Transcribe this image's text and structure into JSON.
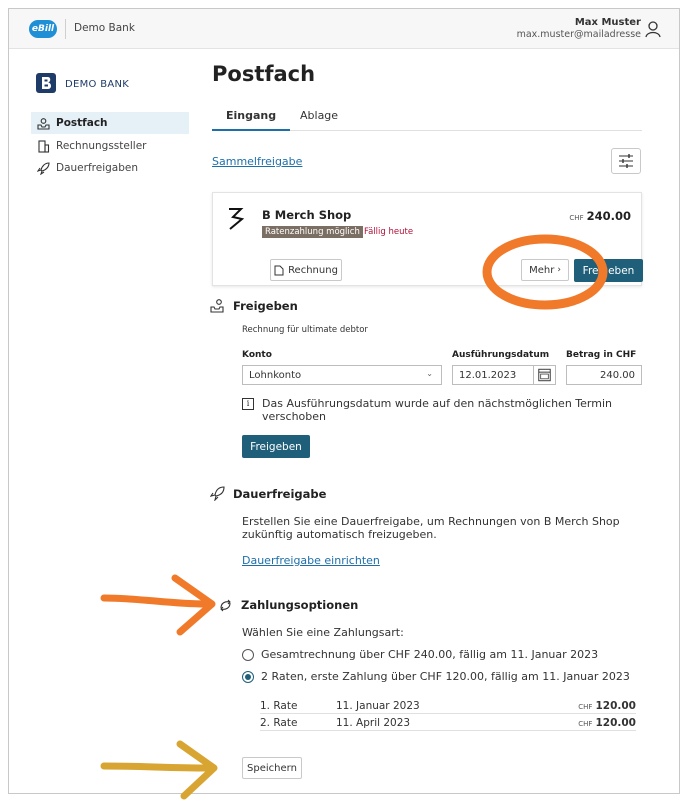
{
  "header": {
    "ebill_logo": "eBill",
    "bank_name": "Demo Bank",
    "user_name": "Max Muster",
    "user_email": "max.muster@mailadresse"
  },
  "sidebar": {
    "logo_text": "DEMO BANK",
    "items": [
      {
        "label": "Postfach",
        "icon": "inbox-person-icon",
        "active": true
      },
      {
        "label": "Rechnungssteller",
        "icon": "document-icon",
        "active": false
      },
      {
        "label": "Dauerfreigaben",
        "icon": "rocket-icon",
        "active": false
      }
    ]
  },
  "main": {
    "title": "Postfach",
    "tabs": [
      {
        "label": "Eingang",
        "active": true
      },
      {
        "label": "Ablage",
        "active": false
      }
    ],
    "sammelfreigabe_link": "Sammelfreigabe",
    "bill": {
      "merchant": "B Merch Shop",
      "currency": "CHF",
      "amount": "240.00",
      "badge": "Ratenzahlung möglich",
      "due_label": "Fällig heute",
      "invoice_button": "Rechnung",
      "more_button": "Mehr",
      "approve_button": "Freigeben"
    },
    "freigeben": {
      "title": "Freigeben",
      "subtitle": "Rechnung für ultimate debtor",
      "konto_label": "Konto",
      "konto_value": "Lohnkonto",
      "date_label": "Ausführungsdatum",
      "date_value": "12.01.2023",
      "amount_label": "Betrag in CHF",
      "amount_value": "240.00",
      "info_text": "Das Ausführungsdatum wurde auf den nächstmöglichen Termin verschoben",
      "submit_button": "Freigeben"
    },
    "dauerfreigabe": {
      "title": "Dauerfreigabe",
      "description": "Erstellen Sie eine Dauerfreigabe, um Rechnungen von B Merch Shop zukünftig automatisch freizugeben.",
      "link": "Dauerfreigabe einrichten"
    },
    "zahlungsoptionen": {
      "title": "Zahlungsoptionen",
      "prompt": "Wählen Sie eine Zahlungsart:",
      "options": [
        {
          "label": "Gesamtrechnung über CHF 240.00, fällig am 11. Januar 2023",
          "selected": false
        },
        {
          "label": "2 Raten, erste Zahlung über CHF 120.00, fällig am 11. Januar 2023",
          "selected": true
        }
      ],
      "rates": [
        {
          "label": "1. Rate",
          "date": "11. Januar 2023",
          "currency": "CHF",
          "amount": "120.00"
        },
        {
          "label": "2. Rate",
          "date": "11. April 2023",
          "currency": "CHF",
          "amount": "120.00"
        }
      ],
      "save_button": "Speichern"
    }
  },
  "annotations": {
    "circle_color": "#f07a2a",
    "arrow_orange_color": "#f07a2a",
    "arrow_gold_color": "#d9a532"
  }
}
